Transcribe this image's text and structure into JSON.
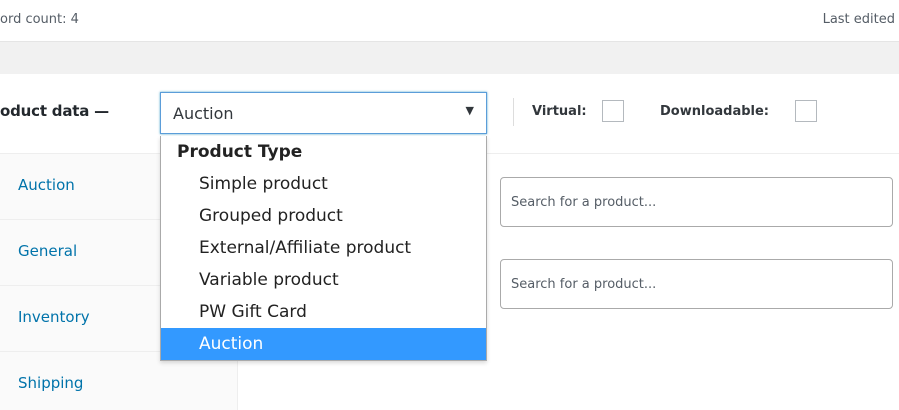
{
  "status": {
    "word_count": "ord count: 4",
    "last_edited": "Last edited"
  },
  "product_data": {
    "title": "oduct data —",
    "type_select": {
      "value": "Auction",
      "options_group": "Product Type",
      "options": [
        "Simple product",
        "Grouped product",
        "External/Affiliate product",
        "Variable product",
        "PW Gift Card",
        "Auction"
      ],
      "selected": "Auction"
    },
    "virtual_label": "Virtual:",
    "downloadable_label": "Downloadable:",
    "tabs": [
      "Auction",
      "General",
      "Inventory",
      "Shipping"
    ],
    "search_fields": [
      {
        "placeholder": "Search for a product..."
      },
      {
        "placeholder": "Search for a product..."
      }
    ]
  },
  "colors": {
    "link": "#0073aa",
    "highlight": "#3399ff",
    "focus_border": "#5b9dd9"
  },
  "icons": {
    "select_arrow": "triangle-down-icon"
  }
}
